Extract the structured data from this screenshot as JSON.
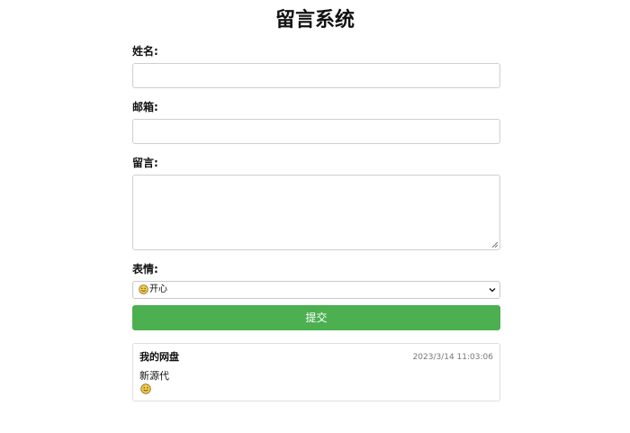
{
  "page": {
    "title": "留言系统"
  },
  "form": {
    "name_label": "姓名:",
    "name_value": "",
    "email_label": "邮箱:",
    "email_value": "",
    "message_label": "留言:",
    "message_value": "",
    "emotion_label": "表情:",
    "emotion_selected": "开心",
    "emotion_icon": "smiley-face-icon",
    "submit_label": "提交"
  },
  "messages": [
    {
      "name": "我的网盘",
      "time": "2023/3/14 11:03:06",
      "content": "新源代",
      "emoji_icon": "smiley-face-icon"
    }
  ],
  "colors": {
    "submit_button": "#4caf50",
    "emoji": "#f2c94c",
    "border": "#cfcfcf"
  }
}
